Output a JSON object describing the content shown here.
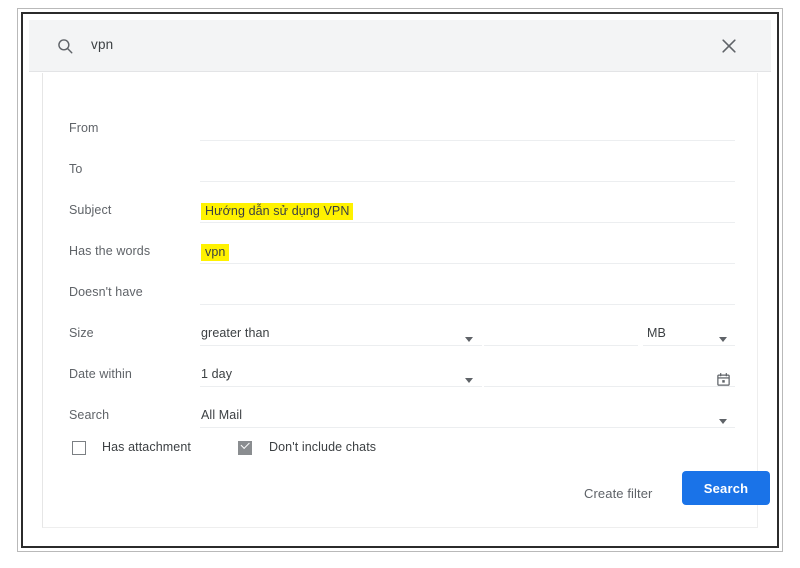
{
  "search_bar": {
    "icon": "search-icon",
    "query": "vpn",
    "close_icon": "close-icon"
  },
  "form": {
    "rows": [
      {
        "label": "From",
        "value": "",
        "highlighted": false,
        "type": "text"
      },
      {
        "label": "To",
        "value": "",
        "highlighted": false,
        "type": "text"
      },
      {
        "label": "Subject",
        "value": "Hướng dẫn sử dụng VPN",
        "highlighted": true,
        "type": "text"
      },
      {
        "label": "Has the words",
        "value": "vpn",
        "highlighted": true,
        "type": "text"
      },
      {
        "label": "Doesn't have",
        "value": "",
        "highlighted": false,
        "type": "text"
      },
      {
        "label": "Size",
        "value": "greater than",
        "highlighted": false,
        "type": "select"
      },
      {
        "label": "Date within",
        "value": "1 day",
        "highlighted": false,
        "type": "select"
      },
      {
        "label": "Search",
        "value": "All Mail",
        "highlighted": false,
        "type": "select-wide"
      }
    ],
    "size_unit": {
      "label": "MB",
      "icon": "chevron-down-icon"
    },
    "size_amount": "",
    "date_value": "",
    "date_icon": "calendar-icon"
  },
  "checkboxes": [
    {
      "label": "Has attachment",
      "checked": false
    },
    {
      "label": "Don't include chats",
      "checked": true
    }
  ],
  "actions": {
    "create_filter": "Create filter",
    "search": "Search"
  },
  "colors": {
    "accent_blue": "#1a73e8",
    "highlight_yellow": "#fff200",
    "label_gray": "#5f6368",
    "header_bg": "#f3f4f5"
  }
}
